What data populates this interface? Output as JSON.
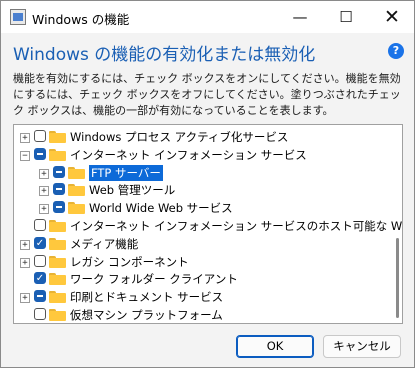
{
  "window": {
    "title": "Windows の機能",
    "minimize_glyph": "—",
    "maximize_glyph": "☐",
    "close_glyph": "✕"
  },
  "header": {
    "heading": "Windows の機能の有効化または無効化",
    "help_glyph": "?"
  },
  "description": "機能を有効にするには、チェック ボックスをオンにしてください。機能を無効にするには、チェック ボックスをオフにしてください。塗りつぶされたチェック ボックスは、機能の一部が有効になっていることを表します。",
  "tree": {
    "items": [
      {
        "label": "Windows プロセス アクティブ化サービス",
        "state": "empty",
        "expandable": true,
        "expanded": false,
        "level": 0
      },
      {
        "label": "インターネット インフォメーション サービス",
        "state": "partial",
        "expandable": true,
        "expanded": true,
        "level": 0
      },
      {
        "label": "FTP サーバー",
        "state": "partial",
        "expandable": true,
        "expanded": false,
        "level": 1,
        "selected": true
      },
      {
        "label": "Web 管理ツール",
        "state": "partial",
        "expandable": true,
        "expanded": false,
        "level": 1
      },
      {
        "label": "World Wide Web サービス",
        "state": "partial",
        "expandable": true,
        "expanded": false,
        "level": 1
      },
      {
        "label": "インターネット インフォメーション サービスのホスト可能な Web コア",
        "state": "empty",
        "expandable": false,
        "level": 0
      },
      {
        "label": "メディア機能",
        "state": "checked",
        "expandable": true,
        "expanded": false,
        "level": 0
      },
      {
        "label": "レガシ コンポーネント",
        "state": "empty",
        "expandable": true,
        "expanded": false,
        "level": 0
      },
      {
        "label": "ワーク フォルダー クライアント",
        "state": "checked",
        "expandable": false,
        "level": 0
      },
      {
        "label": "印刷とドキュメント サービス",
        "state": "partial",
        "expandable": true,
        "expanded": false,
        "level": 0
      },
      {
        "label": "仮想マシン プラットフォーム",
        "state": "empty",
        "expandable": false,
        "level": 0
      }
    ]
  },
  "buttons": {
    "ok": "OK",
    "cancel": "キャンセル"
  }
}
